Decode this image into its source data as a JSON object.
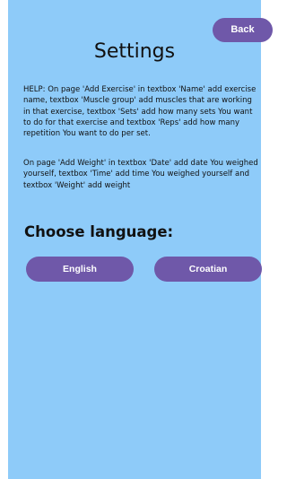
{
  "header": {
    "back_label": "Back",
    "title": "Settings"
  },
  "help": {
    "paragraph1": "HELP: On page 'Add Exercise' in textbox 'Name' add exercise name, textbox 'Muscle group' add muscles that are working in that exercise, textbox 'Sets' add how many sets You want to do for that exercise and textbox 'Reps' add how many repetition You want to do per set.",
    "paragraph2": "On page 'Add Weight' in textbox 'Date' add date You weighed yourself, textbox 'Time' add time You weighed yourself and textbox 'Weight' add weight"
  },
  "language": {
    "heading": "Choose language:",
    "options": [
      {
        "label": "English"
      },
      {
        "label": "Croatian"
      }
    ]
  },
  "colors": {
    "background": "#8ecbf9",
    "button": "#6f58a9",
    "button_text": "#ffffff"
  }
}
